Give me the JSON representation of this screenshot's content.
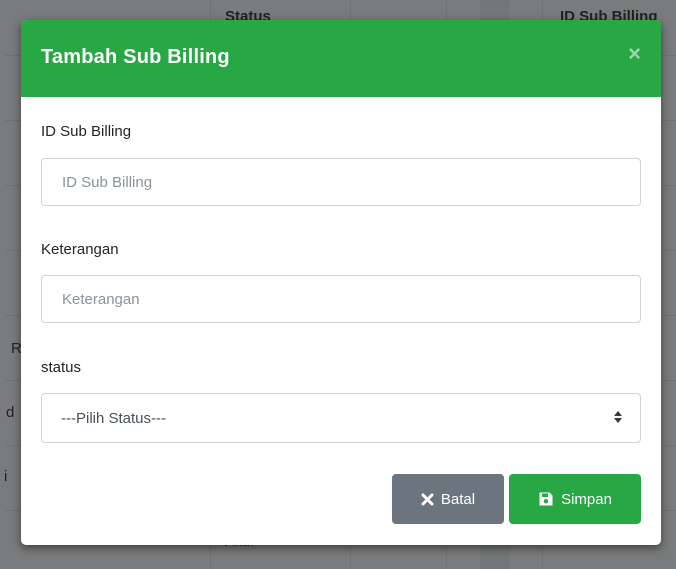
{
  "background": {
    "columns": [
      "Status",
      "ID Sub Billing"
    ],
    "cells": [
      "R",
      "d",
      "i",
      "Aktif"
    ]
  },
  "modal": {
    "title": "Tambah Sub Billing",
    "close_symbol": "×",
    "fields": [
      {
        "label": "ID Sub Billing",
        "placeholder": "ID Sub Billing",
        "value": ""
      },
      {
        "label": "Keterangan",
        "placeholder": "Keterangan",
        "value": ""
      }
    ],
    "status": {
      "label": "status",
      "selected": "---Pilih Status---"
    },
    "buttons": {
      "cancel": {
        "label": "Batal",
        "icon": "times-icon"
      },
      "save": {
        "label": "Simpan",
        "icon": "save-icon"
      }
    }
  },
  "colors": {
    "header": "#28a745",
    "save": "#28a745",
    "cancel": "#6c757d"
  }
}
